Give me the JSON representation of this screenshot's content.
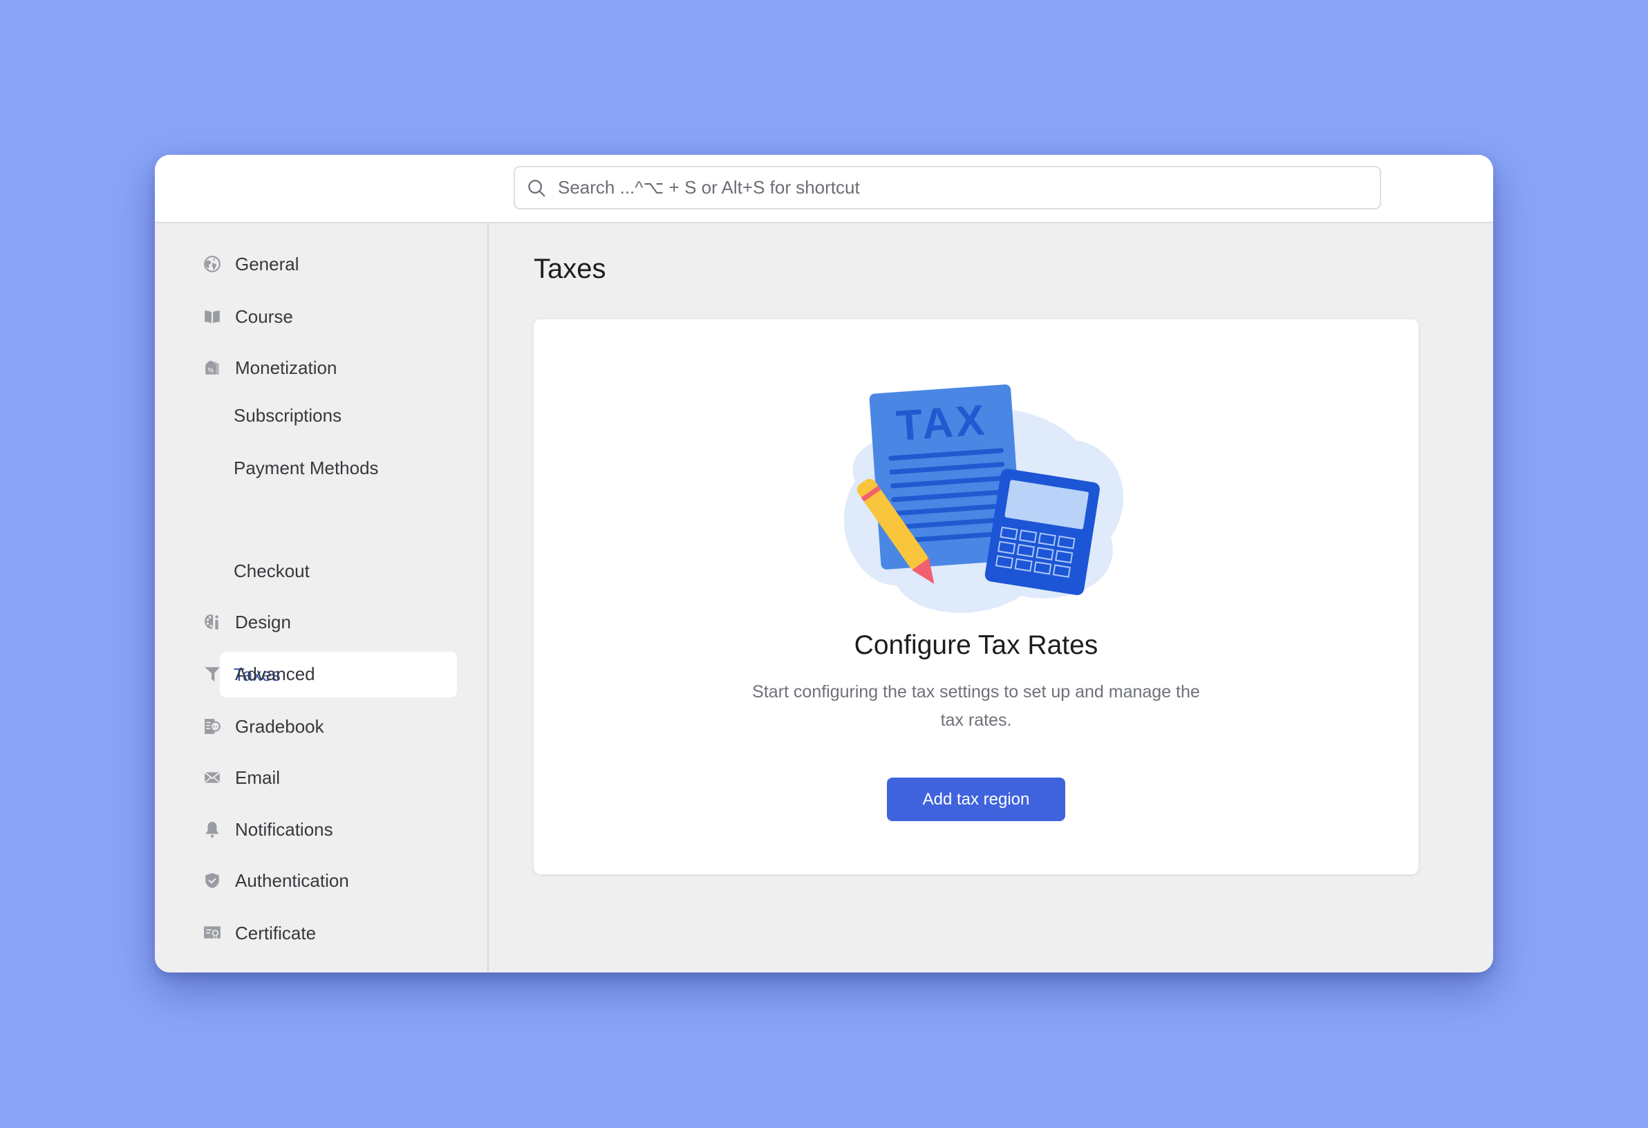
{
  "search": {
    "placeholder": "Search ...^⌥ + S or Alt+S for shortcut",
    "value": ""
  },
  "sidebar": {
    "items": [
      {
        "label": "General",
        "icon": "globe-icon"
      },
      {
        "label": "Course",
        "icon": "book-icon"
      },
      {
        "label": "Monetization",
        "icon": "price-tag-icon"
      },
      {
        "label": "Subscriptions"
      },
      {
        "label": "Payment Methods"
      },
      {
        "label": "Taxes",
        "active": true
      },
      {
        "label": "Checkout"
      },
      {
        "label": "Design",
        "icon": "palette-icon"
      },
      {
        "label": "Advanced",
        "icon": "filter-icon"
      },
      {
        "label": "Gradebook",
        "icon": "gradebook-icon"
      },
      {
        "label": "Email",
        "icon": "envelope-icon"
      },
      {
        "label": "Notifications",
        "icon": "bell-icon"
      },
      {
        "label": "Authentication",
        "icon": "shield-check-icon"
      },
      {
        "label": "Certificate",
        "icon": "certificate-icon"
      }
    ]
  },
  "main": {
    "title": "Taxes",
    "empty_state": {
      "illustration": "tax-document-calculator-illustration",
      "illustration_text": "TAX",
      "heading": "Configure Tax Rates",
      "description": "Start configuring the tax settings to set up and manage the tax rates.",
      "button_label": "Add tax region"
    }
  },
  "colors": {
    "background": "#8aa4f8",
    "accent": "#3f63dc",
    "active_nav_text": "#3d5ab0",
    "icon_gray": "#9a9ca3"
  }
}
